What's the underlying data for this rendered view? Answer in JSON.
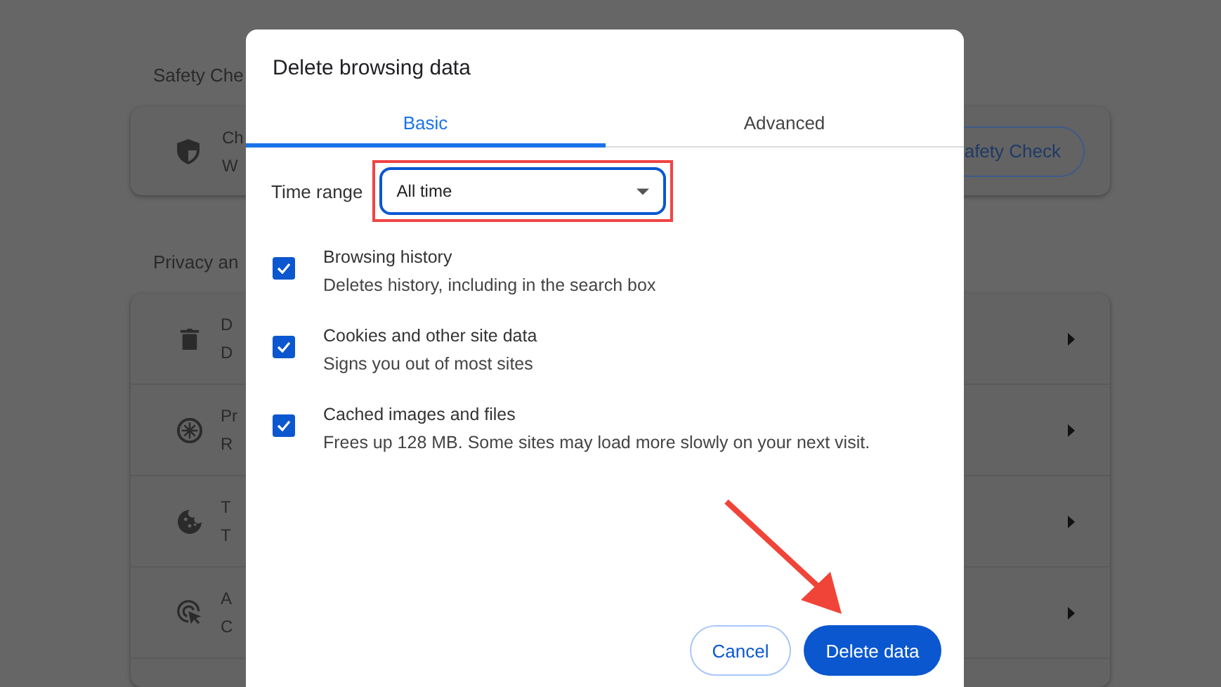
{
  "background": {
    "safety_heading": "Safety Che",
    "safety_card": {
      "title": "Ch",
      "subtitle": "W",
      "button": "afety Check"
    },
    "privacy_heading": "Privacy an",
    "privacy_rows": [
      {
        "kind": "trash",
        "title": "D",
        "subtitle": "D"
      },
      {
        "kind": "compass",
        "title": "Pr",
        "subtitle": "R"
      },
      {
        "kind": "cookie",
        "title": "T",
        "subtitle": "T"
      },
      {
        "kind": "cursor",
        "title": "A",
        "subtitle": "C"
      }
    ]
  },
  "dialog": {
    "title": "Delete browsing data",
    "tabs": [
      {
        "label": "Basic",
        "selected": true
      },
      {
        "label": "Advanced",
        "selected": false
      }
    ],
    "time_range": {
      "label": "Time range",
      "value": "All time"
    },
    "options": [
      {
        "title": "Browsing history",
        "description": "Deletes history, including in the search box",
        "checked": true
      },
      {
        "title": "Cookies and other site data",
        "description": "Signs you out of most sites",
        "checked": true
      },
      {
        "title": "Cached images and files",
        "description": "Frees up 128 MB. Some sites may load more slowly on your next visit.",
        "checked": true
      }
    ],
    "cancel": "Cancel",
    "confirm": "Delete data"
  }
}
